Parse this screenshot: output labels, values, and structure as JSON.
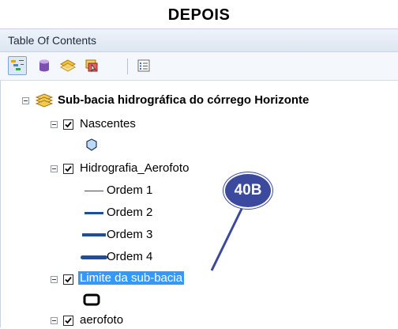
{
  "heading": "DEPOIS",
  "toc": {
    "title": "Table Of Contents",
    "toolbar": [
      {
        "name": "list-by-drawing-order-icon",
        "active": true
      },
      {
        "name": "list-by-source-icon",
        "active": false
      },
      {
        "name": "list-by-visibility-icon",
        "active": false
      },
      {
        "name": "list-by-selection-icon",
        "active": false
      },
      {
        "name": "options-icon",
        "active": false
      }
    ]
  },
  "tree": {
    "group_label": "Sub-bacia hidrográfica do córrego Horizonte",
    "layers": {
      "nascentes": {
        "label": "Nascentes",
        "checked": true,
        "symbol_color": "#bcd9f5"
      },
      "hidrografia": {
        "label": "Hidrografia_Aerofoto",
        "checked": true,
        "classes": [
          {
            "label": "Ordem 1"
          },
          {
            "label": "Ordem 2"
          },
          {
            "label": "Ordem 3"
          },
          {
            "label": "Ordem 4"
          }
        ],
        "line_color": "#1f4e9c"
      },
      "limite": {
        "label": "Limite da sub-bacia",
        "checked": true,
        "selected": true
      },
      "aerofoto": {
        "label": "aerofoto",
        "checked": true
      }
    }
  },
  "callout": {
    "text": "40B",
    "color": "#3b4a9c"
  }
}
